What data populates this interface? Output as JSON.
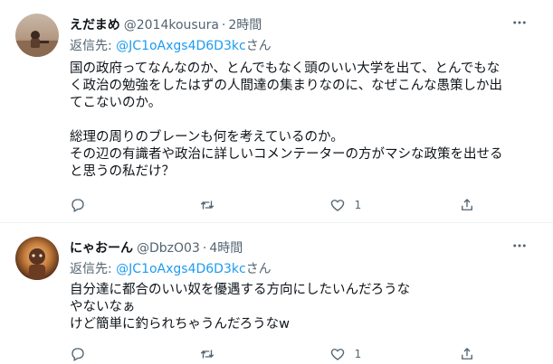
{
  "tweets": [
    {
      "display_name": "えだまめ",
      "handle": "@2014kousura",
      "separator": "·",
      "time": "2時間",
      "reply_prefix": "返信先: ",
      "reply_mention": "@JC1oAxgs4D6D3kc",
      "reply_suffix": "さん",
      "lines": [
        "国の政府ってなんなのか、とんでもなく頭のいい大学を出て、とんでもな",
        "く政治の勉強をしたはずの人間達の集まりなのに、なぜこんな愚策しか出",
        "てこないのか。",
        "",
        "総理の周りのブレーンも何を考えているのか。",
        "その辺の有識者や政治に詳しいコメンテーターの方がマシな政策を出せる",
        "と思うの私だけ？"
      ],
      "reply_count": "",
      "retweet_count": "",
      "like_count": "1"
    },
    {
      "display_name": "にゃおーん",
      "handle": "@DbzO03",
      "separator": "·",
      "time": "4時間",
      "reply_prefix": "返信先: ",
      "reply_mention": "@JC1oAxgs4D6D3kc",
      "reply_suffix": "さん",
      "lines": [
        "自分達に都合のいい奴を優遇する方向にしたいんだろうな",
        "やないなぁ",
        "けど簡単に釣られちゃうんだろうなw"
      ],
      "reply_count": "",
      "retweet_count": "",
      "like_count": "1"
    }
  ],
  "colors": {
    "text": "#0f1419",
    "secondary": "#536471",
    "mention": "#1d9bf0",
    "divider": "#eff3f4"
  },
  "icons": [
    "more-icon",
    "reply-icon",
    "retweet-icon",
    "like-icon",
    "share-icon"
  ]
}
